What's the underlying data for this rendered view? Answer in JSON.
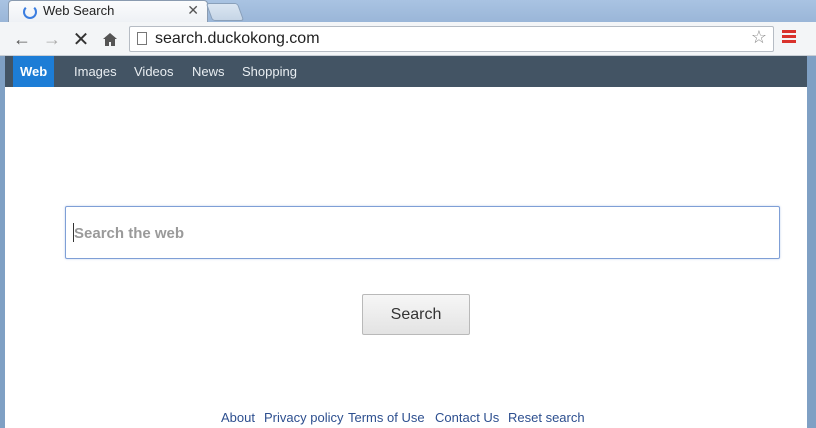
{
  "browser": {
    "tab_title": "Web Search",
    "url": "search.duckokong.com",
    "icons": {
      "back": "arrow-left-icon",
      "forward": "arrow-right-icon",
      "stop": "close-icon",
      "home": "home-icon",
      "bookmark": "star-icon",
      "menu": "hamburger-menu-icon"
    },
    "menu_color": "#d9322c"
  },
  "site_nav": {
    "items": [
      {
        "label": "Web",
        "active": true
      },
      {
        "label": "Images",
        "active": false
      },
      {
        "label": "Videos",
        "active": false
      },
      {
        "label": "News",
        "active": false
      },
      {
        "label": "Shopping",
        "active": false
      }
    ],
    "bar_color": "#435464",
    "active_color": "#1d7dd6"
  },
  "search": {
    "placeholder": "Search the web",
    "value": "",
    "button_label": "Search"
  },
  "footer": {
    "links": [
      "About",
      "Privacy policy",
      "Terms of Use",
      "Contact Us",
      "Reset search"
    ]
  }
}
